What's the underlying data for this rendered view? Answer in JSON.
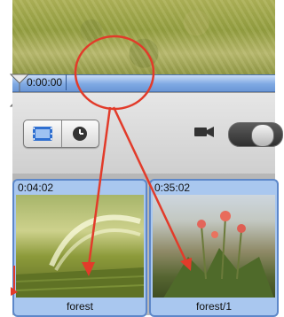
{
  "timeline": {
    "timecode": "0:00:00"
  },
  "toolbar": {
    "view_buttons": [
      {
        "name": "filmstrip-view-icon"
      },
      {
        "name": "clock-view-icon"
      }
    ]
  },
  "clips": [
    {
      "time": "0:04:02",
      "label": "forest"
    },
    {
      "time": "0:35:02",
      "label": "forest/1"
    }
  ],
  "annotation": {
    "color": "#e23b2a"
  }
}
